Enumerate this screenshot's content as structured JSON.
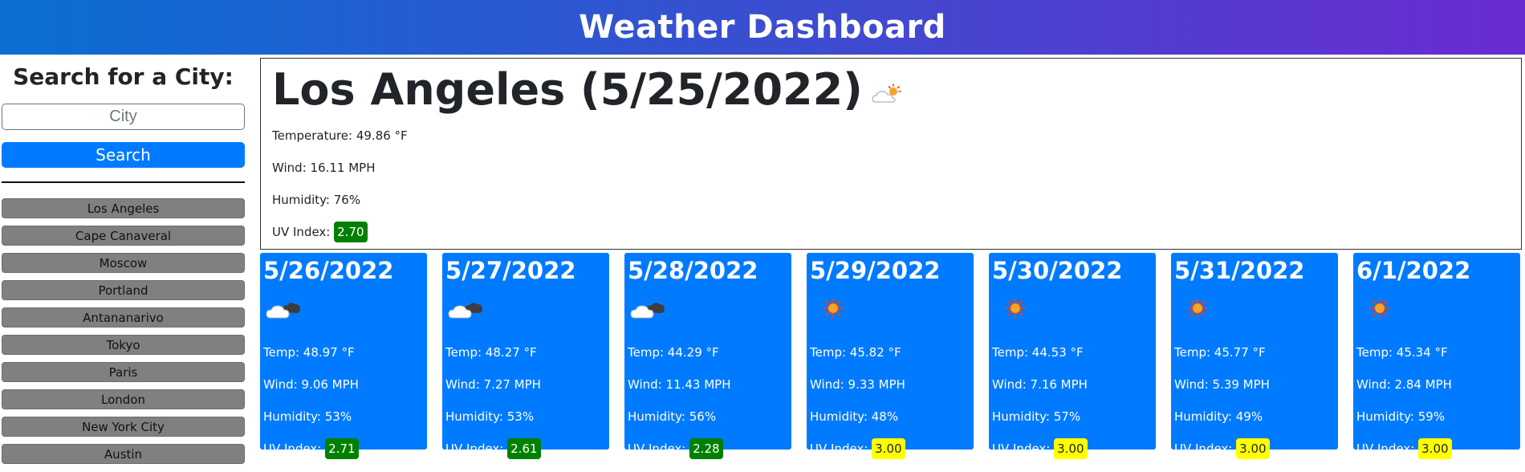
{
  "header": {
    "title": "Weather Dashboard"
  },
  "sidebar": {
    "heading": "Search for a City:",
    "search_input": {
      "placeholder": "City",
      "value": ""
    },
    "search_button": "Search",
    "history": [
      "Los Angeles",
      "Cape Canaveral",
      "Moscow",
      "Portland",
      "Antananarivo",
      "Tokyo",
      "Paris",
      "London",
      "New York City",
      "Austin"
    ]
  },
  "current": {
    "title": "Los Angeles (5/25/2022)",
    "icon": "partly-cloudy-sun-icon",
    "temperature": "Temperature: 49.86 °F",
    "wind": "Wind: 16.11 MPH",
    "humidity": "Humidity: 76%",
    "uv_label": "UV Index:",
    "uv_value": "2.70",
    "uv_level": "low"
  },
  "forecast": [
    {
      "date": "5/26/2022",
      "icon": "cloudy-icon",
      "temp": "Temp: 48.97 °F",
      "wind": "Wind: 9.06 MPH",
      "humidity": "Humidity: 53%",
      "uv_label": "UV Index:",
      "uv_value": "2.71",
      "uv_level": "low"
    },
    {
      "date": "5/27/2022",
      "icon": "cloudy-icon",
      "temp": "Temp: 48.27 °F",
      "wind": "Wind: 7.27 MPH",
      "humidity": "Humidity: 53%",
      "uv_label": "UV Index:",
      "uv_value": "2.61",
      "uv_level": "low"
    },
    {
      "date": "5/28/2022",
      "icon": "cloudy-icon",
      "temp": "Temp: 44.29 °F",
      "wind": "Wind: 11.43 MPH",
      "humidity": "Humidity: 56%",
      "uv_label": "UV Index:",
      "uv_value": "2.28",
      "uv_level": "low"
    },
    {
      "date": "5/29/2022",
      "icon": "sun-icon",
      "temp": "Temp: 45.82 °F",
      "wind": "Wind: 9.33 MPH",
      "humidity": "Humidity: 48%",
      "uv_label": "UV Index:",
      "uv_value": "3.00",
      "uv_level": "moderate"
    },
    {
      "date": "5/30/2022",
      "icon": "sun-icon",
      "temp": "Temp: 44.53 °F",
      "wind": "Wind: 7.16 MPH",
      "humidity": "Humidity: 57%",
      "uv_label": "UV Index:",
      "uv_value": "3.00",
      "uv_level": "moderate"
    },
    {
      "date": "5/31/2022",
      "icon": "sun-icon",
      "temp": "Temp: 45.77 °F",
      "wind": "Wind: 5.39 MPH",
      "humidity": "Humidity: 49%",
      "uv_label": "UV Index:",
      "uv_value": "3.00",
      "uv_level": "moderate"
    },
    {
      "date": "6/1/2022",
      "icon": "sun-icon",
      "temp": "Temp: 45.34 °F",
      "wind": "Wind: 2.84 MPH",
      "humidity": "Humidity: 59%",
      "uv_label": "UV Index:",
      "uv_value": "3.00",
      "uv_level": "moderate"
    }
  ],
  "colors": {
    "accent": "#007bff",
    "uv_low": "#008000",
    "uv_moderate": "#ffff00",
    "history_button": "#808080"
  }
}
